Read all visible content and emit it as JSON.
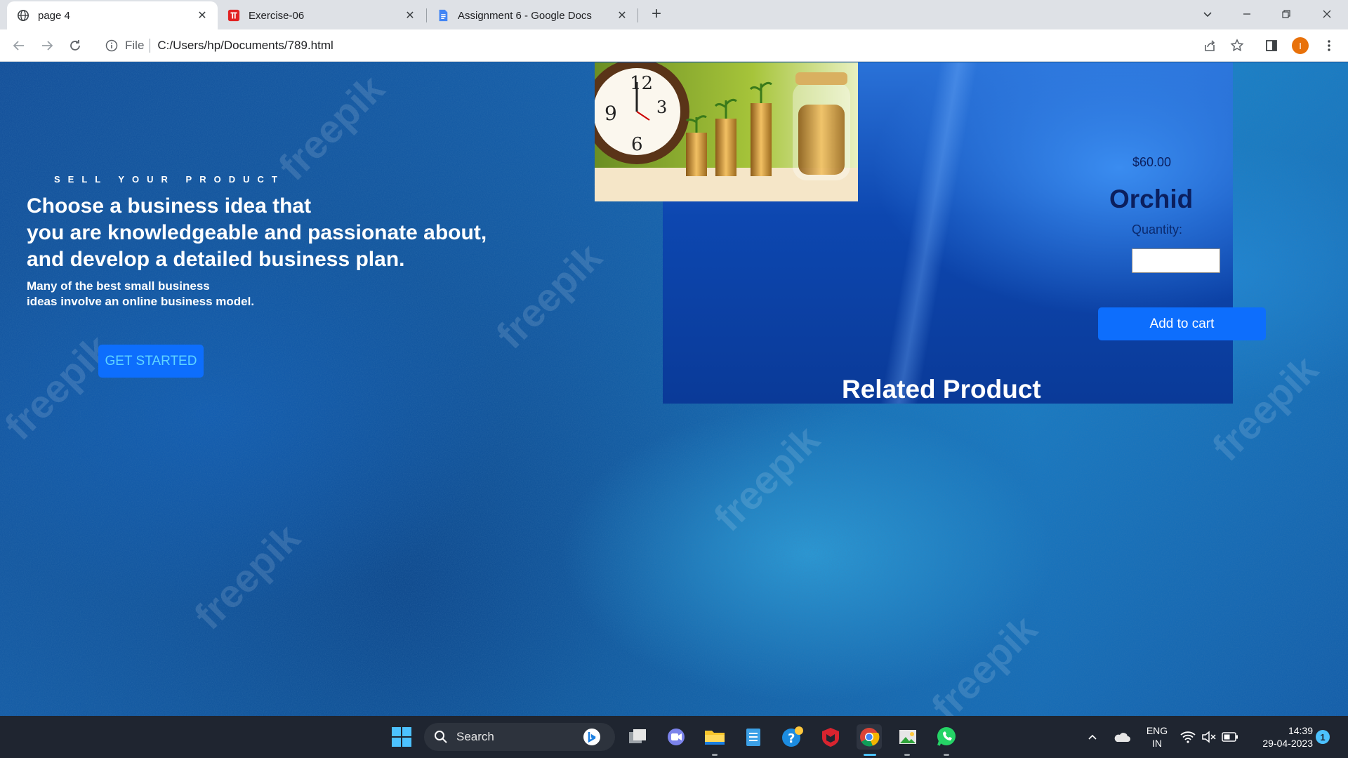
{
  "browser": {
    "tabs": [
      {
        "title": "page 4",
        "icon": "globe-icon",
        "active": true
      },
      {
        "title": "Exercise-06",
        "icon": "exercise-favicon-icon",
        "active": false
      },
      {
        "title": "Assignment 6 - Google Docs",
        "icon": "google-docs-icon",
        "active": false
      }
    ],
    "address": {
      "scheme": "File",
      "path": "C:/Users/hp/Documents/789.html"
    },
    "profile_initial": "I"
  },
  "hero": {
    "eyebrow": "SELL YOUR PRODUCT",
    "headline": [
      "Choose a business idea that",
      "you are knowledgeable and passionate about,",
      "and develop a detailed business plan."
    ],
    "subline": [
      "Many of the best small business",
      "ideas involve an online business model."
    ],
    "cta_label": "GET STARTED"
  },
  "product": {
    "price": "$60.00",
    "name": "Orchid",
    "quantity_label": "Quantity:",
    "quantity_value": "",
    "add_to_cart_label": "Add to cart",
    "related_heading": "Related Product"
  },
  "watermark_text": "freepik",
  "taskbar": {
    "search_label": "Search",
    "lang_top": "ENG",
    "lang_bottom": "IN",
    "time": "14:39",
    "date": "29-04-2023",
    "notification_count": "1"
  },
  "colors": {
    "accent_button": "#0d6efd",
    "product_text": "#0b1f5e",
    "taskbar_bg": "#1f2530"
  }
}
